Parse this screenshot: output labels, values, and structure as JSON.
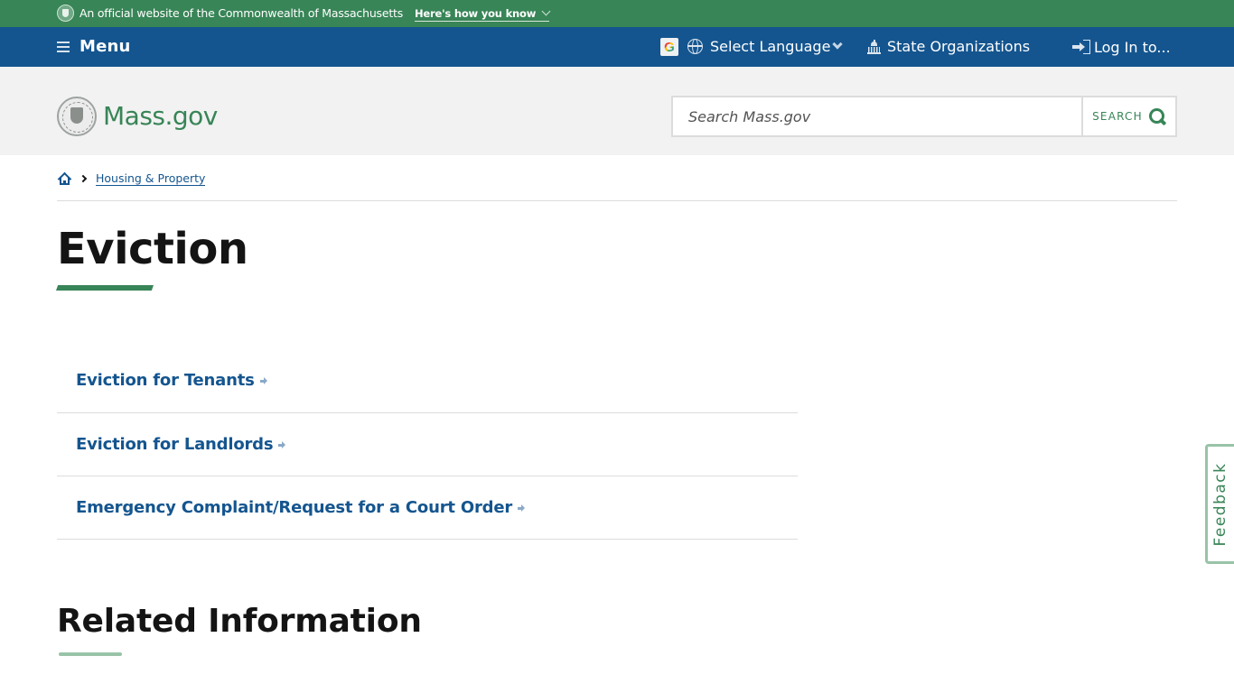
{
  "official_banner": {
    "text": "An official website of the Commonwealth of Massachusetts",
    "how_you_know": "Here's how you know"
  },
  "utility_nav": {
    "menu_label": "Menu",
    "google_logo": "G",
    "language_label": "Select Language",
    "state_orgs_label": "State Organizations",
    "login_label": "Log In to..."
  },
  "header": {
    "wordmark": "Mass.gov",
    "search": {
      "placeholder": "Search Mass.gov",
      "value": "",
      "button_label": "SEARCH"
    }
  },
  "breadcrumb": {
    "items": [
      {
        "label": "Housing & Property"
      }
    ]
  },
  "page": {
    "title": "Eviction",
    "links": [
      {
        "label": "Eviction for Tenants"
      },
      {
        "label": "Eviction for Landlords"
      },
      {
        "label": "Emergency Complaint/Request for a Court Order"
      }
    ],
    "related_heading": "Related Information"
  },
  "feedback": {
    "label": "Feedback"
  },
  "colors": {
    "brand_green": "#388557",
    "nav_blue": "#14558f",
    "header_gray": "#f2f2f2",
    "text_dark": "#141414",
    "divider": "#dcdcdc",
    "light_green": "#99c3a8"
  }
}
